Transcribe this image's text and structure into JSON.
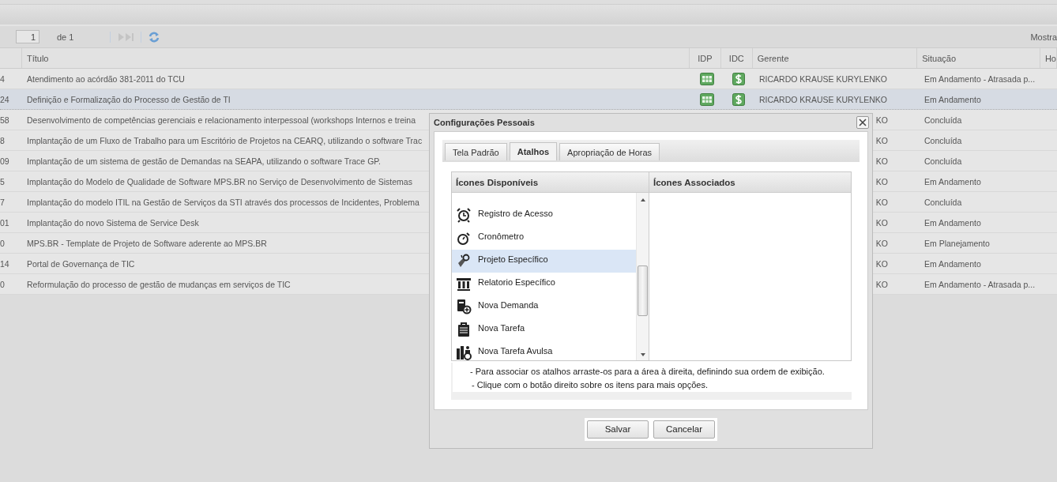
{
  "pager": {
    "page": "1",
    "of": "de 1",
    "right_label": "Mostra"
  },
  "table": {
    "columns": [
      "Título",
      "IDP",
      "IDC",
      "Gerente",
      "Situação",
      "Ho"
    ],
    "rows": [
      {
        "id": "4",
        "title": "Atendimento ao acórdão 381-2011 do TCU",
        "icons": true,
        "gerente": "RICARDO KRAUSE KURYLENKO",
        "gerente_clipped": false,
        "situacao": "Em Andamento - Atrasada p...",
        "selected": false
      },
      {
        "id": "24",
        "title": "Definição e Formalização do Processo de Gestão de TI",
        "icons": true,
        "gerente": "RICARDO KRAUSE KURYLENKO",
        "gerente_clipped": false,
        "situacao": "Em Andamento",
        "selected": true
      },
      {
        "id": "58",
        "title": "Desenvolvimento de competências gerenciais e relacionamento interpessoal (workshops Internos e treina",
        "icons": false,
        "gerente": "KO",
        "gerente_clipped": true,
        "situacao": "Concluída",
        "selected": false
      },
      {
        "id": "8",
        "title": "Implantação de um Fluxo de Trabalho para um Escritório de Projetos na CEARQ, utilizando o software Trac",
        "icons": false,
        "gerente": "KO",
        "gerente_clipped": true,
        "situacao": "Concluída",
        "selected": false
      },
      {
        "id": "09",
        "title": "Implantação de um sistema de gestão de Demandas na SEAPA, utilizando o software Trace GP.",
        "icons": false,
        "gerente": "KO",
        "gerente_clipped": true,
        "situacao": "Concluída",
        "selected": false
      },
      {
        "id": "5",
        "title": "Implantação do Modelo de Qualidade de Software MPS.BR no Serviço de Desenvolvimento de Sistemas",
        "icons": false,
        "gerente": "KO",
        "gerente_clipped": true,
        "situacao": "Em Andamento",
        "selected": false
      },
      {
        "id": "7",
        "title": "Implantação do modelo ITIL na Gestão de Serviços da STI através dos processos de Incidentes, Problema",
        "icons": false,
        "gerente": "KO",
        "gerente_clipped": true,
        "situacao": "Concluída",
        "selected": false
      },
      {
        "id": "01",
        "title": "Implantação do novo Sistema de Service Desk",
        "icons": false,
        "gerente": "KO",
        "gerente_clipped": true,
        "situacao": "Em Andamento",
        "selected": false
      },
      {
        "id": "0",
        "title": "MPS.BR - Template de Projeto de Software aderente ao MPS.BR",
        "icons": false,
        "gerente": "KO",
        "gerente_clipped": true,
        "situacao": "Em Planejamento",
        "selected": false
      },
      {
        "id": "14",
        "title": "Portal de Governança de TIC",
        "icons": false,
        "gerente": "KO",
        "gerente_clipped": true,
        "situacao": "Em Andamento",
        "selected": false
      },
      {
        "id": "0",
        "title": "Reformulação do processo de gestão de mudanças em serviços de TIC",
        "icons": false,
        "gerente": "KO",
        "gerente_clipped": true,
        "situacao": "Em Andamento - Atrasada p...",
        "selected": false
      }
    ]
  },
  "dialog": {
    "title": "Configurações Pessoais",
    "tabs": [
      {
        "label": "Tela Padrão",
        "selected": false
      },
      {
        "label": "Atalhos",
        "selected": true
      },
      {
        "label": "Apropriação de Horas",
        "selected": false
      }
    ],
    "available_header": "Ícones Disponíveis",
    "associated_header": "Ícones Associados",
    "available": [
      {
        "label": "Registro de Acesso",
        "selected": false
      },
      {
        "label": "Cronômetro",
        "selected": false
      },
      {
        "label": "Projeto Específico",
        "selected": true
      },
      {
        "label": "Relatorio Específico",
        "selected": false
      },
      {
        "label": "Nova Demanda",
        "selected": false
      },
      {
        "label": "Nova Tarefa",
        "selected": false
      },
      {
        "label": "Nova Tarefa Avulsa",
        "selected": false
      }
    ],
    "hints": [
      "- Para associar os atalhos arraste-os para a área à direita, definindo sua ordem de exibição.",
      "- Clique com o botão direito sobre os itens para mais opções."
    ],
    "buttons": [
      "Salvar",
      "Cancelar"
    ]
  }
}
